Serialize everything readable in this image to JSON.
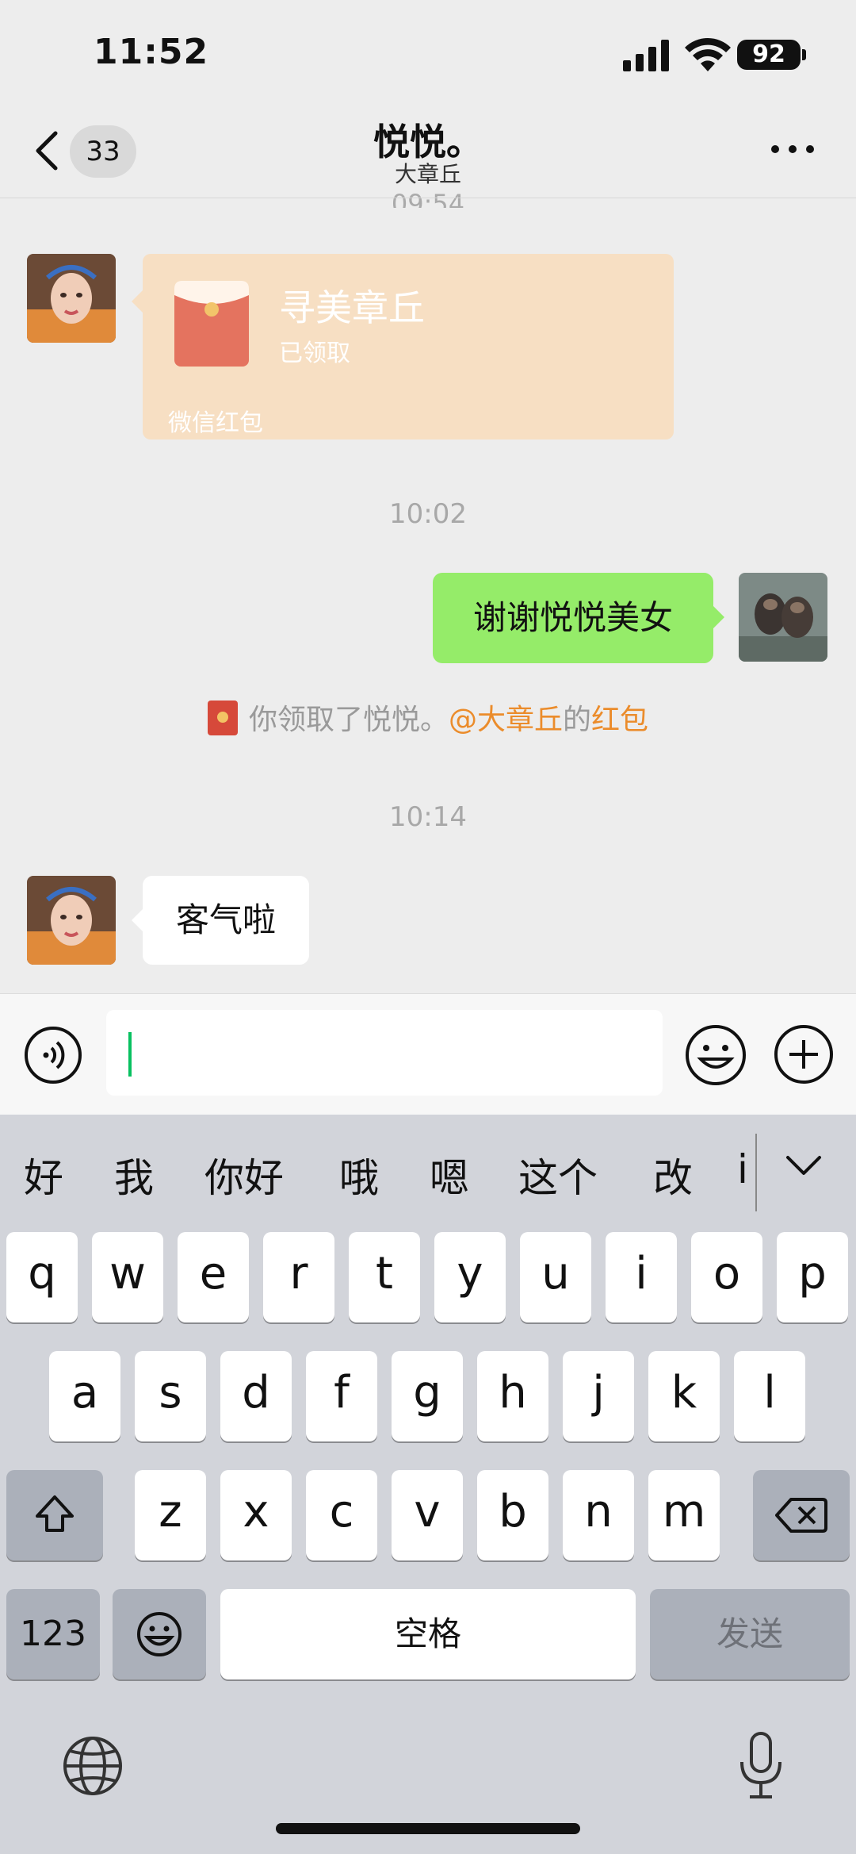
{
  "status_bar": {
    "time": "11:52",
    "battery": "92"
  },
  "nav": {
    "unread_count": "33",
    "title": "悦悦。",
    "subtitle": "大章丘"
  },
  "messages": {
    "cutoff_timestamp": "09:54",
    "red_packet": {
      "title": "寻美章丘",
      "status": "已领取",
      "footer": "微信红包"
    },
    "timestamp_1": "10:02",
    "outgoing_text": "谢谢悦悦美女",
    "system_notice": {
      "prefix": "你领取了悦悦。",
      "mention": "@大章丘",
      "middle": "的",
      "link": "红包"
    },
    "timestamp_2": "10:14",
    "incoming_text": "客气啦"
  },
  "input": {
    "value": ""
  },
  "keyboard": {
    "candidates": [
      "好",
      "我",
      "你好",
      "哦",
      "嗯",
      "这个",
      "改",
      "i"
    ],
    "row1": [
      "q",
      "w",
      "e",
      "r",
      "t",
      "y",
      "u",
      "i",
      "o",
      "p"
    ],
    "row2": [
      "a",
      "s",
      "d",
      "f",
      "g",
      "h",
      "j",
      "k",
      "l"
    ],
    "row3": [
      "z",
      "x",
      "c",
      "v",
      "b",
      "n",
      "m"
    ],
    "numbers_key": "123",
    "space_key": "空格",
    "send_key": "发送"
  },
  "icons": {
    "back": "chevron-left-icon",
    "more": "more-dots-icon",
    "voice": "voice-icon",
    "emoji": "emoji-icon",
    "plus": "plus-icon",
    "shift": "shift-icon",
    "delete": "backspace-icon",
    "globe": "globe-icon",
    "mic": "microphone-icon"
  },
  "colors": {
    "accent_green": "#95ec69",
    "link_orange": "#eb8c2b",
    "red_packet_bg": "#f7dfc3",
    "caret": "#07c160"
  }
}
